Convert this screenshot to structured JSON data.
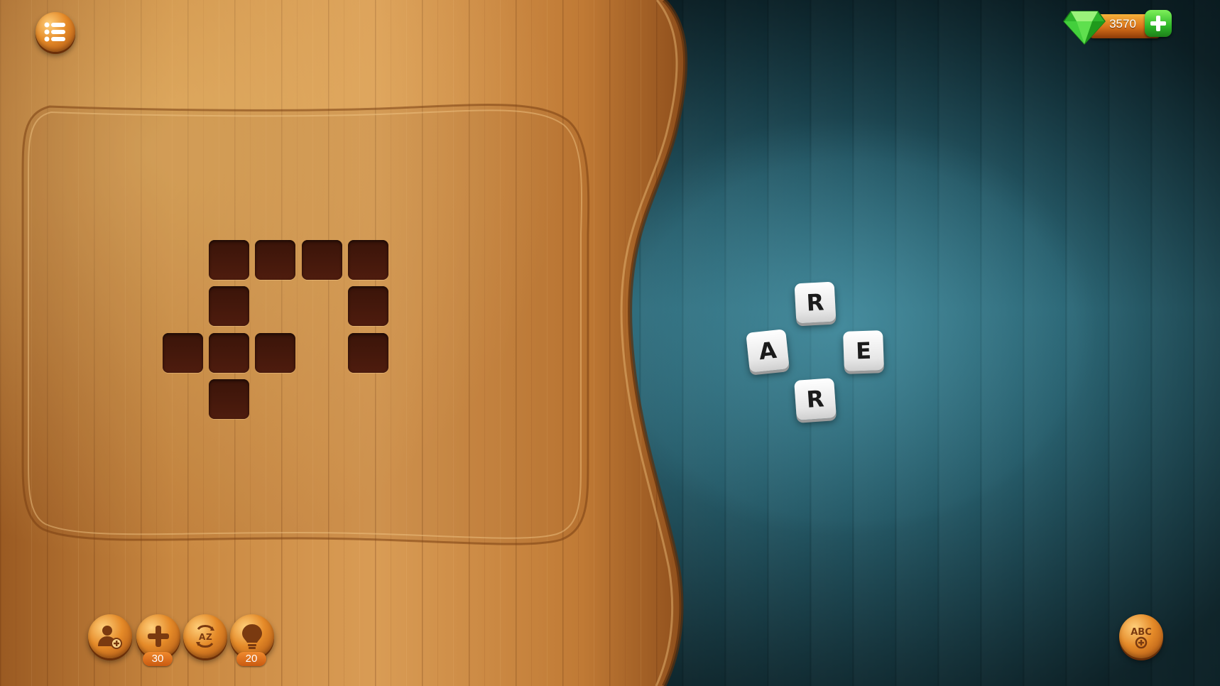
{
  "topbar": {
    "menu_icon": "menu-list-icon",
    "gem_icon": "green-gem-icon",
    "gem_count": "3570",
    "add_gems_icon": "plus-icon"
  },
  "puzzle_grid": {
    "rows": 4,
    "cols": 5,
    "filled_cells": [
      {
        "row": 0,
        "col": 1
      },
      {
        "row": 0,
        "col": 2
      },
      {
        "row": 0,
        "col": 3
      },
      {
        "row": 0,
        "col": 4
      },
      {
        "row": 1,
        "col": 1
      },
      {
        "row": 1,
        "col": 4
      },
      {
        "row": 2,
        "col": 0
      },
      {
        "row": 2,
        "col": 1
      },
      {
        "row": 2,
        "col": 2
      },
      {
        "row": 2,
        "col": 4
      },
      {
        "row": 3,
        "col": 1
      }
    ]
  },
  "letter_wheel": {
    "letters": [
      {
        "char": "R",
        "position": "top"
      },
      {
        "char": "A",
        "position": "left"
      },
      {
        "char": "E",
        "position": "right"
      },
      {
        "char": "R",
        "position": "bottom"
      }
    ]
  },
  "bottom_toolbar": {
    "buttons": [
      {
        "name": "ask-friend",
        "icon": "person-add-icon"
      },
      {
        "name": "reveal-letter",
        "icon": "plus-icon",
        "cost": "30"
      },
      {
        "name": "shuffle",
        "icon": "shuffle-az-icon"
      },
      {
        "name": "hint",
        "icon": "lightbulb-icon",
        "cost": "20"
      }
    ],
    "extra_words_button": {
      "icon": "abc-add-icon",
      "label": "ABC"
    }
  },
  "colors": {
    "wood_light": "#d79a52",
    "wood_dark": "#8a4f1e",
    "cell_fill": "#451809",
    "teal_bg": "#2a6574",
    "button_orange": "#e58a28",
    "badge_orange": "#e0772a",
    "gem_green": "#3ccf3a"
  }
}
